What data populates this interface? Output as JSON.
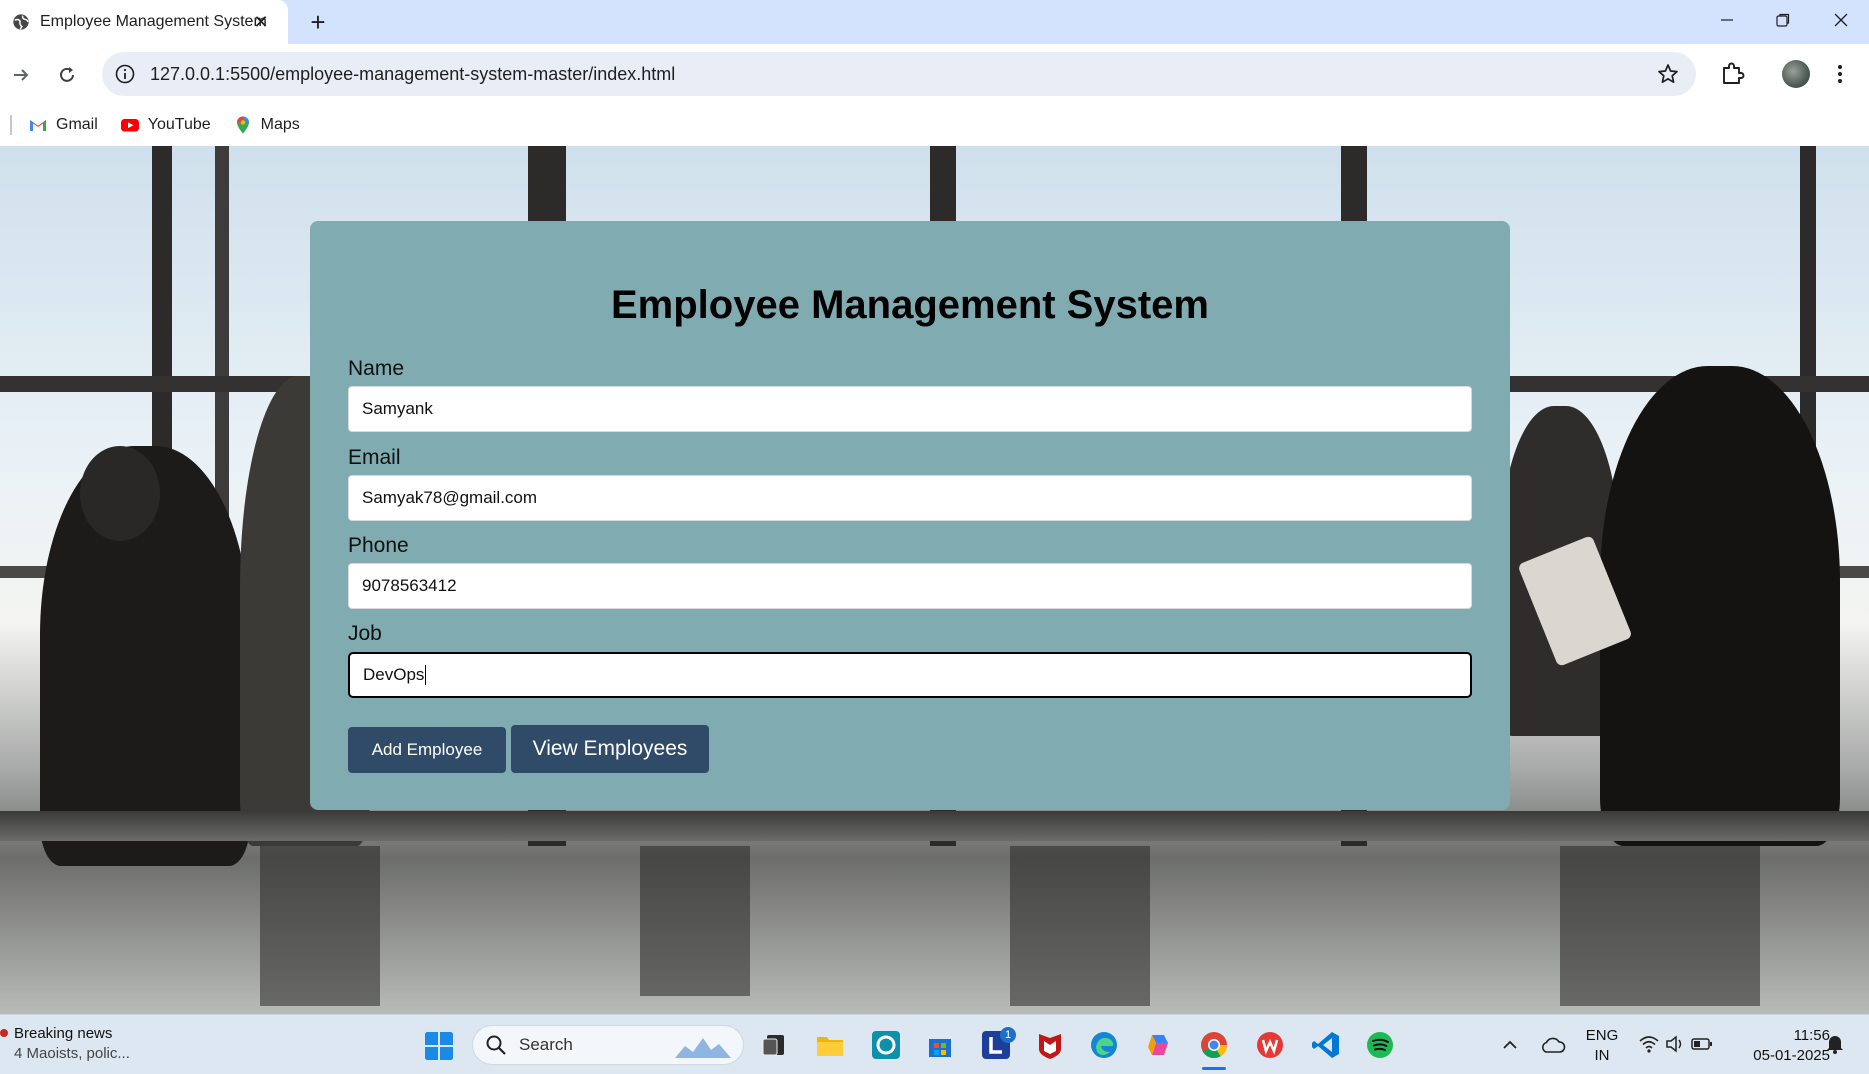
{
  "browser": {
    "tab_title": "Employee Management System",
    "url": "127.0.0.1:5500/employee-management-system-master/index.html",
    "bookmarks": [
      {
        "label": "Gmail",
        "icon": "gmail-icon"
      },
      {
        "label": "YouTube",
        "icon": "youtube-icon"
      },
      {
        "label": "Maps",
        "icon": "maps-icon"
      }
    ]
  },
  "form": {
    "title": "Employee Management System",
    "fields": [
      {
        "label": "Name",
        "value": "Samyank"
      },
      {
        "label": "Email",
        "value": "Samyak78@gmail.com"
      },
      {
        "label": "Phone",
        "value": "9078563412"
      },
      {
        "label": "Job",
        "value": "DevOps"
      }
    ],
    "add_button": "Add Employee",
    "view_button": "View Employees",
    "colors": {
      "card": "#80abb0",
      "button": "#2f4b68"
    }
  },
  "taskbar": {
    "news_title": "Breaking news",
    "news_sub": "4 Maoists, polic...",
    "search_placeholder": "Search",
    "l_badge": "1",
    "lang_top": "ENG",
    "lang_bottom": "IN",
    "time": "11:56",
    "date": "05-01-2025"
  }
}
